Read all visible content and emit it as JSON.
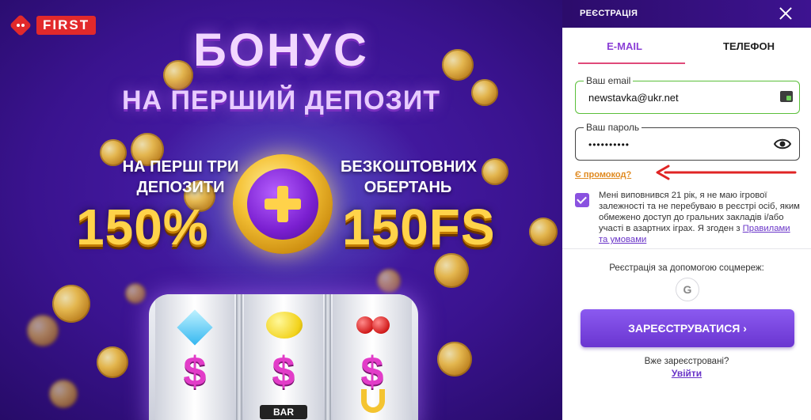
{
  "brand": {
    "name": "FIRST",
    "accent": "#e2292b"
  },
  "promo": {
    "headline": "БОНУС",
    "subheadline": "НА ПЕРШИЙ ДЕПОЗИТ",
    "left_text": "НА ПЕРШІ ТРИ ДЕПОЗИТИ",
    "right_text": "БЕЗКОШТОВНИХ ОБЕРТАНЬ",
    "left_big": "150%",
    "right_big": "150FS",
    "slot_symbol_bar": "BAR",
    "slot_symbol_dollar": "$"
  },
  "panel": {
    "title": "РЕЄСТРАЦІЯ",
    "tabs": [
      {
        "label": "E-MAIL",
        "active": true
      },
      {
        "label": "ТЕЛЕФОН",
        "active": false
      }
    ],
    "email": {
      "label": "Ваш email",
      "value": "newstavka@ukr.net"
    },
    "password": {
      "label": "Ваш пароль",
      "value": "••••••••••"
    },
    "promo_link": "Є промокод?",
    "consent": {
      "text": "Мені виповнився 21 рік, я не маю ігрової залежності та не перебуваю в реєстрі осіб, яким обмежено доступ до гральних закладів і/або участі в азартних іграх. Я згоден з ",
      "link": "Правилами та умовами",
      "checked": true
    },
    "social_label": "Реєстрація за допомогою соцмереж:",
    "google_glyph": "G",
    "submit_label": "ЗАРЕЄСТРУВАТИСЯ ›",
    "already_label": "Вже зареєстровані?",
    "login_label": "Увійти"
  },
  "colors": {
    "primary": "#8b5af0",
    "header": "#2c0c6b",
    "valid": "#5bbf3a",
    "arrow": "#e02424"
  }
}
